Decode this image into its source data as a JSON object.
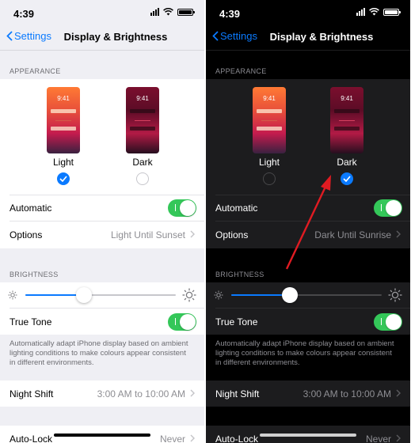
{
  "status": {
    "time": "4:39"
  },
  "nav": {
    "back": "Settings",
    "title": "Display & Brightness"
  },
  "sections": {
    "appearance": "APPEARANCE",
    "brightness": "BRIGHTNESS"
  },
  "phones": {
    "clock": "9:41",
    "light_label": "Light",
    "dark_label": "Dark"
  },
  "light_panel": {
    "automatic": "Automatic",
    "options_label": "Options",
    "options_value": "Light Until Sunset",
    "selected_mode": "Light"
  },
  "dark_panel": {
    "automatic": "Automatic",
    "options_label": "Options",
    "options_value": "Dark Until Sunrise",
    "selected_mode": "Dark"
  },
  "brightness": {
    "level_fraction": 0.39
  },
  "true_tone": {
    "label": "True Tone",
    "footnote": "Automatically adapt iPhone display based on ambient lighting conditions to make colours appear consistent in different environments."
  },
  "night_shift": {
    "label": "Night Shift",
    "value": "3:00 AM to 10:00 AM"
  },
  "auto_lock": {
    "label": "Auto-Lock",
    "value": "Never"
  },
  "colors": {
    "accent": "#0a7aff",
    "toggle_on": "#34c759",
    "annotation_arrow": "#e01b22"
  }
}
